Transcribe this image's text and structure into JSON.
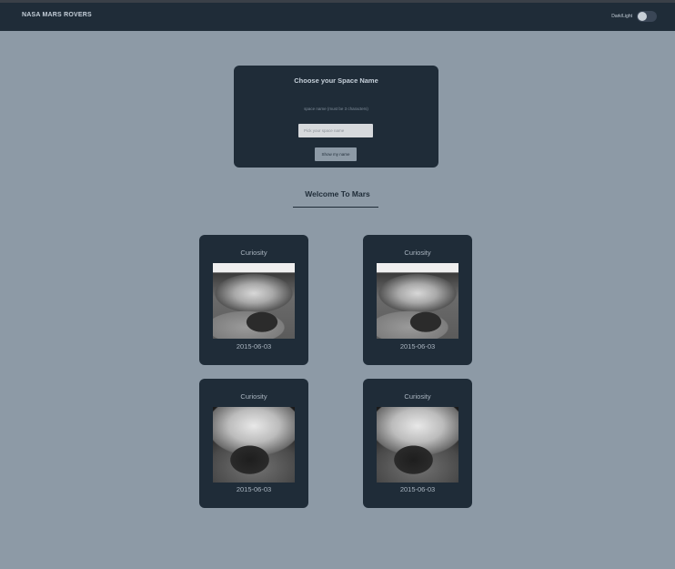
{
  "navbar": {
    "brand": "NASA MARS ROVERS",
    "theme_toggle_label": "Dark/Light"
  },
  "name_form": {
    "title": "Choose your Space Name",
    "hint": "space name (must be 3 characters)",
    "input_placeholder": "Pick your space name",
    "input_value": "",
    "submit_label": "Show my name"
  },
  "welcome": {
    "heading": "Welcome To Mars"
  },
  "rovers": [
    {
      "name": "Curiosity",
      "date": "2015-06-03"
    },
    {
      "name": "Curiosity",
      "date": "2015-06-03"
    },
    {
      "name": "Curiosity",
      "date": "2015-06-03"
    },
    {
      "name": "Curiosity",
      "date": "2015-06-03"
    }
  ],
  "colors": {
    "page_background": "#8d9aa6",
    "panel": "#1f2c38",
    "text_light": "#c5cfd9",
    "text_dark": "#1f2c38"
  }
}
